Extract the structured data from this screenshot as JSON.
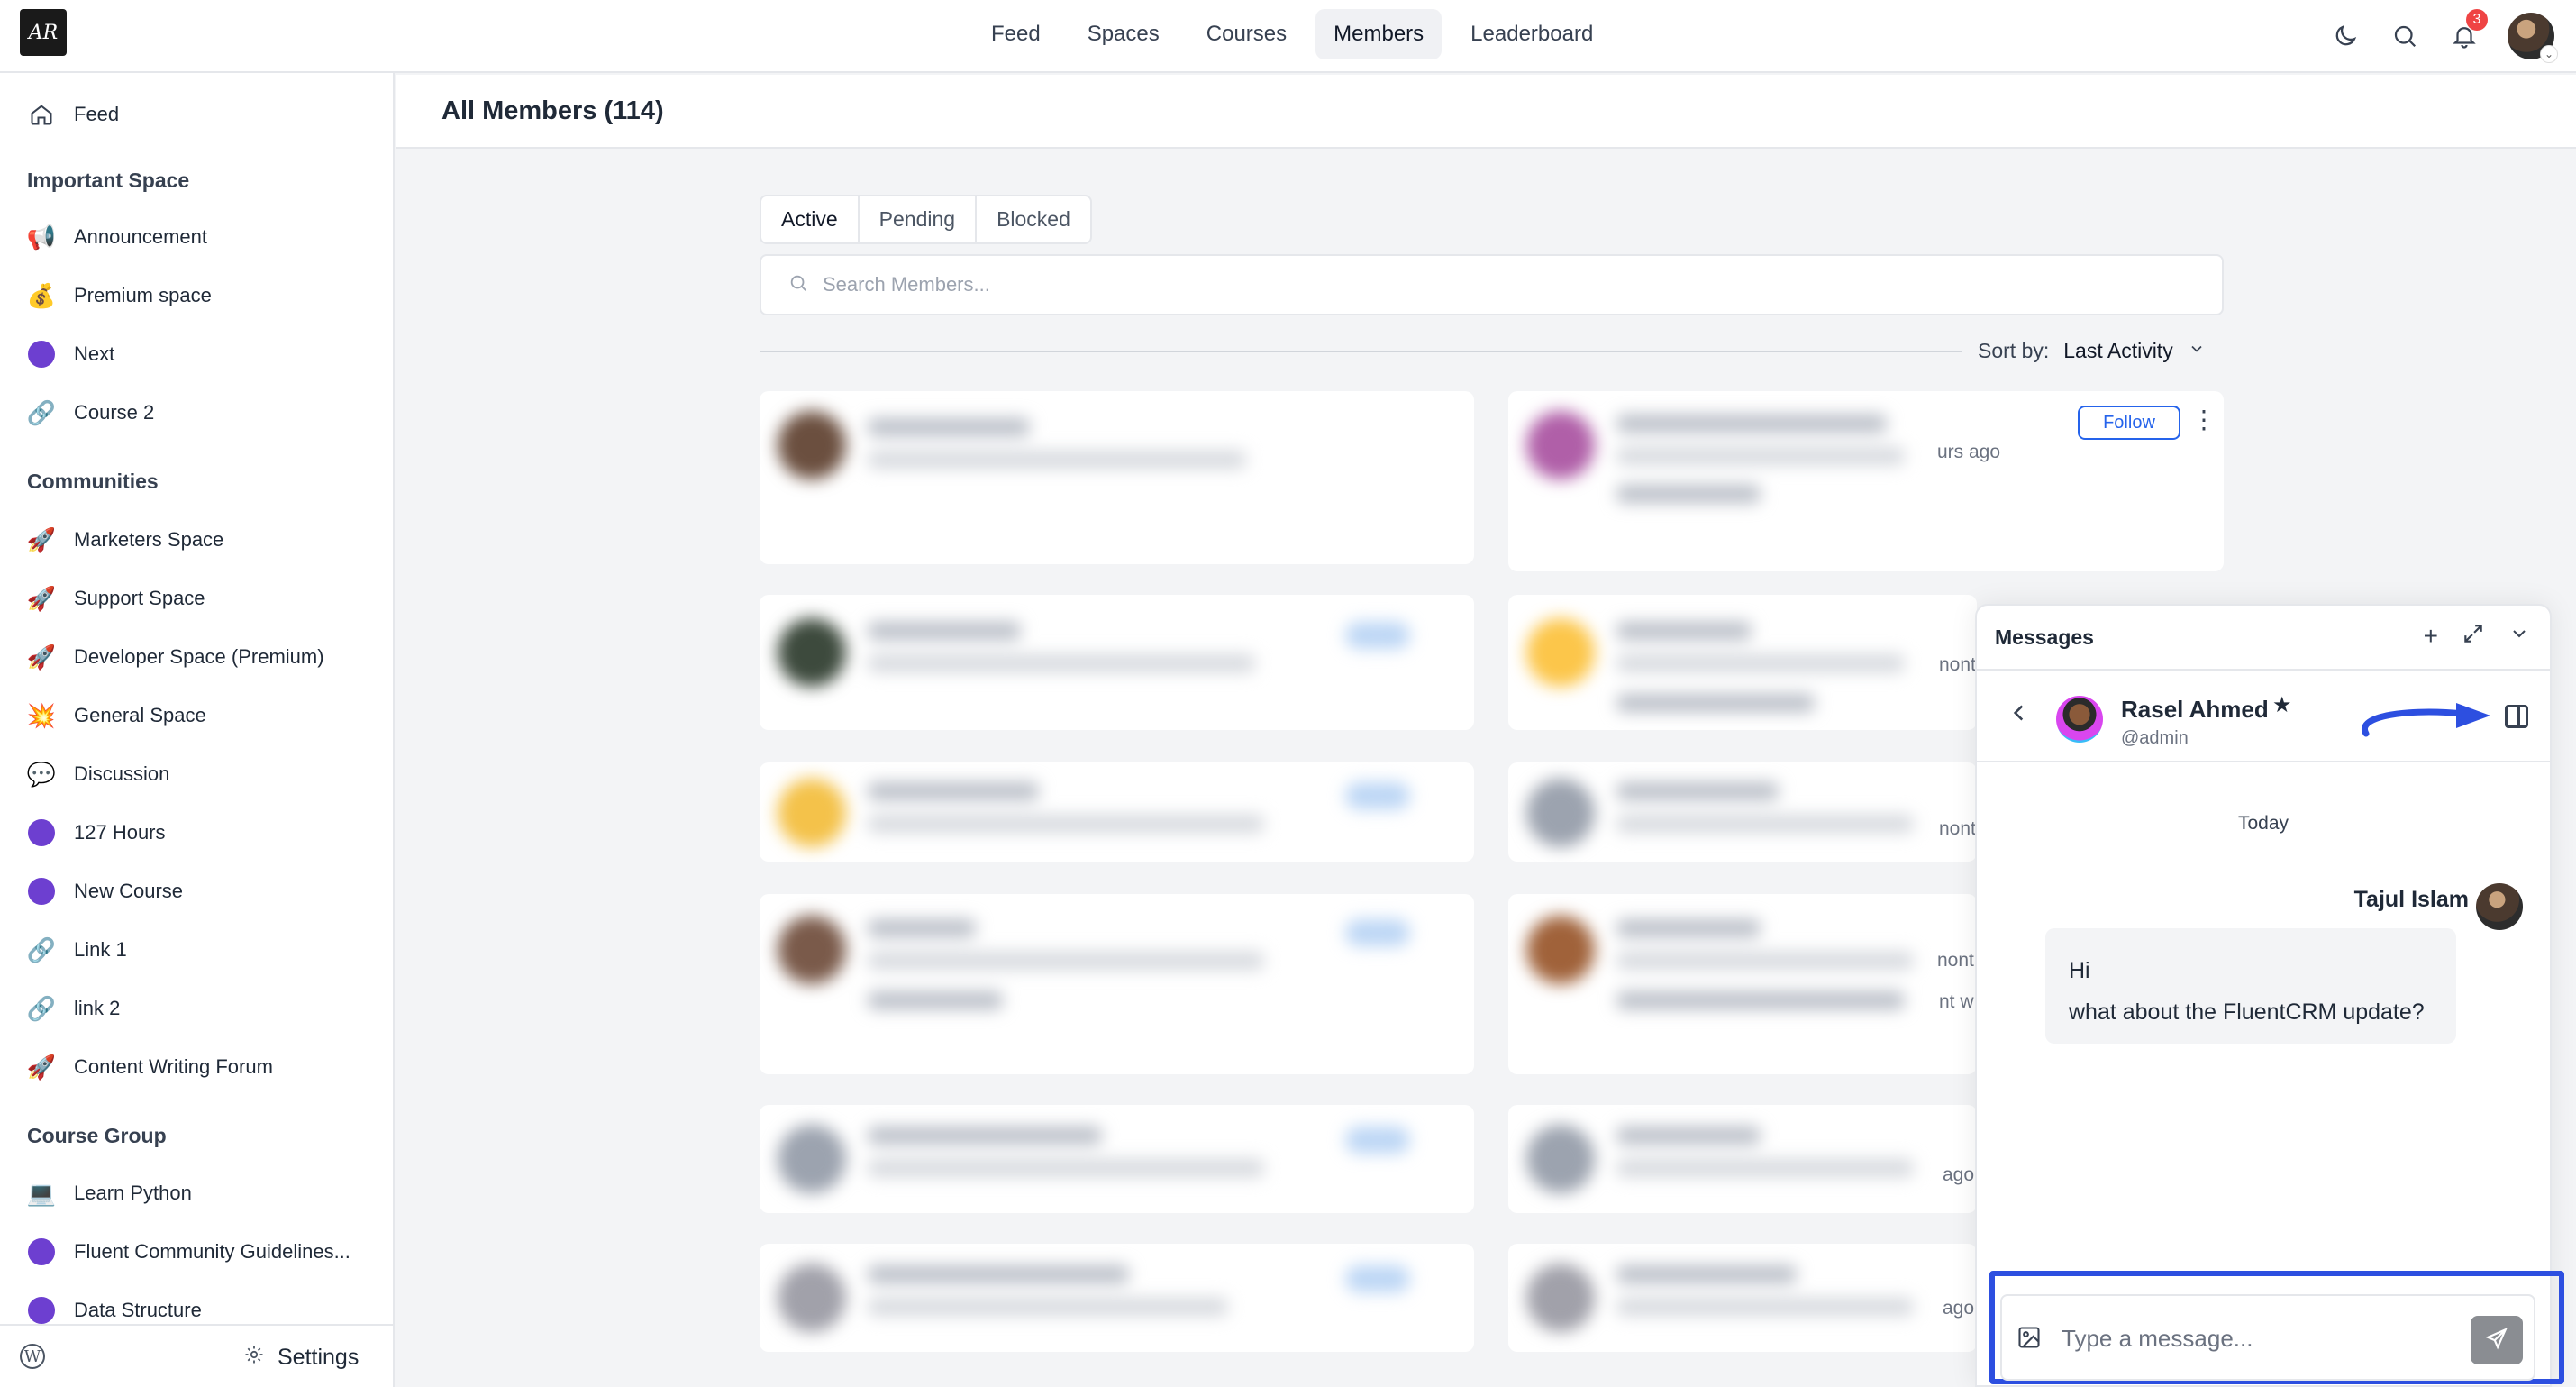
{
  "logo": {
    "text": "AR"
  },
  "nav": {
    "items": [
      {
        "label": "Feed"
      },
      {
        "label": "Spaces"
      },
      {
        "label": "Courses"
      },
      {
        "label": "Members"
      },
      {
        "label": "Leaderboard"
      }
    ],
    "active": "Members"
  },
  "notifications": {
    "count": "3"
  },
  "sidebar": {
    "feed": "Feed",
    "groups": [
      {
        "title": "Important Space",
        "items": [
          "Announcement",
          "Premium space",
          "Next",
          "Course 2"
        ]
      },
      {
        "title": "Communities",
        "items": [
          "Marketers Space",
          "Support Space",
          "Developer Space (Premium)",
          "General Space",
          "Discussion",
          "127 Hours",
          "New Course",
          "Link 1",
          "link 2",
          "Content Writing Forum"
        ]
      },
      {
        "title": "Course Group",
        "items": [
          "Learn Python",
          "Fluent Community Guidelines...",
          "Data Structure"
        ]
      }
    ],
    "settings": "Settings"
  },
  "main": {
    "title": "All Members (114)",
    "tabs": [
      "Active",
      "Pending",
      "Blocked"
    ],
    "search_placeholder": "Search Members...",
    "sort_label": "Sort by:",
    "sort_value": "Last Activity",
    "follow_label": "Follow",
    "peek_texts": [
      "urs ago",
      "nont",
      "nont",
      "nonth",
      "nt w",
      "ago",
      "ago"
    ]
  },
  "messages": {
    "title": "Messages",
    "contact_name": "Rasel Ahmed",
    "contact_handle": "@admin",
    "day": "Today",
    "sender": "Tajul Islam",
    "lines": [
      "Hi",
      "what about the FluentCRM update?"
    ],
    "input_placeholder": "Type a message..."
  },
  "colors": {
    "accent": "#2563eb",
    "highlight": "#2d4fe0",
    "space_dot": "#6d3fd0"
  }
}
